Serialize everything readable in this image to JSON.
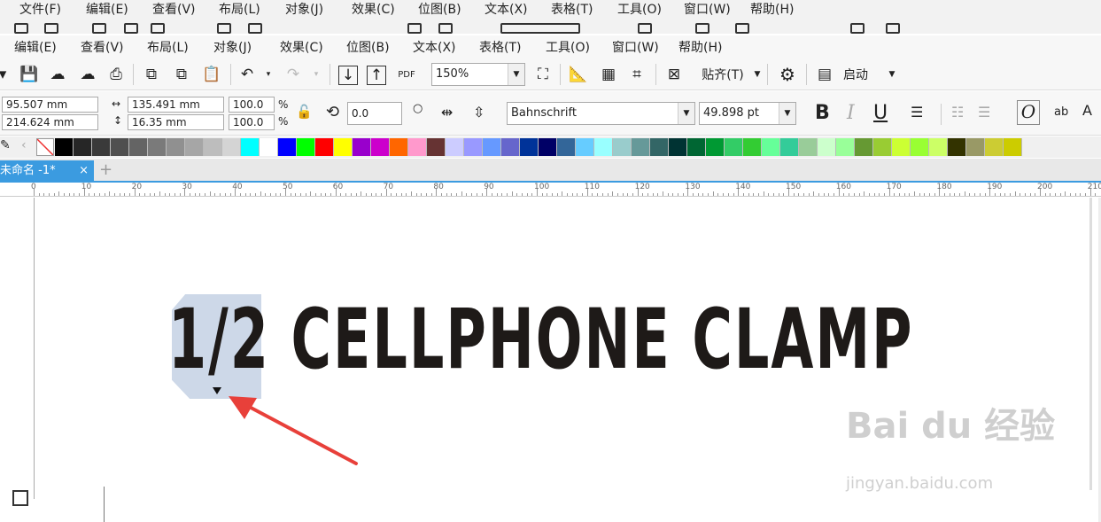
{
  "ghost_menu": [
    "文件(F)",
    "编辑(E)",
    "查看(V)",
    "布局(L)",
    "对象(J)",
    "效果(C)",
    "位图(B)",
    "文本(X)",
    "表格(T)",
    "工具(O)",
    "窗口(W)",
    "帮助(H)"
  ],
  "menu": [
    "编辑(E)",
    "查看(V)",
    "布局(L)",
    "对象(J)",
    "效果(C)",
    "位图(B)",
    "文本(X)",
    "表格(T)",
    "工具(O)",
    "窗口(W)",
    "帮助(H)"
  ],
  "toolbar": {
    "zoom_value": "150%",
    "snap_label": "贴齐(T)",
    "launch_label": "启动",
    "pdf_label": "PDF"
  },
  "propbar": {
    "x": "95.507 mm",
    "y": "214.624 mm",
    "width": "135.491 mm",
    "height": "16.35 mm",
    "scale_x": "100.0",
    "scale_y": "100.0",
    "pct": "%",
    "rotation": "0.0",
    "font_name": "Bahnschrift",
    "font_size": "49.898 pt",
    "bold": "B",
    "italic": "I",
    "underline": "U",
    "ab_label": "ab"
  },
  "palette_colors": [
    "#000000",
    "#262626",
    "#3a3a3a",
    "#4f4f4f",
    "#646464",
    "#7a7a7a",
    "#909090",
    "#a6a6a6",
    "#bdbdbd",
    "#d4d4d4",
    "#00ffff",
    "#ffffff",
    "#0000ff",
    "#00ff00",
    "#ff0000",
    "#ffff00",
    "#9900cc",
    "#cc00cc",
    "#ff6600",
    "#ff99cc",
    "#663333",
    "#ccccff",
    "#9999ff",
    "#6699ff",
    "#6666cc",
    "#003399",
    "#000066",
    "#336699",
    "#66ccff",
    "#99ffff",
    "#99cccc",
    "#669999",
    "#336666",
    "#003333",
    "#006633",
    "#009933",
    "#33cc66",
    "#33cc33",
    "#66ff99",
    "#33cc99",
    "#99cc99",
    "#ccffcc",
    "#99ff99",
    "#669933",
    "#99cc33",
    "#ccff33",
    "#99ff33",
    "#ccff66",
    "#333300",
    "#999966",
    "#cccc33",
    "#cccc00"
  ],
  "tab": {
    "title": "未命名 -1*",
    "close": "×",
    "add": "+"
  },
  "ruler_labels": [
    "0",
    "10",
    "20",
    "30",
    "40",
    "50",
    "60",
    "70",
    "80",
    "90",
    "100",
    "110",
    "120",
    "130",
    "140",
    "150",
    "160",
    "170",
    "180",
    "190",
    "200",
    "210"
  ],
  "canvas": {
    "headline": "1/2 CELLPHONE CLAMP",
    "selected_part": "1/2"
  },
  "watermark": {
    "main": "Bai du 经验",
    "sub": "jingyan.baidu.com"
  },
  "colors": {
    "accent": "#3b9be0",
    "arrow": "#e8403a",
    "selection": "#cdd8e8",
    "text": "#1e1a18"
  }
}
